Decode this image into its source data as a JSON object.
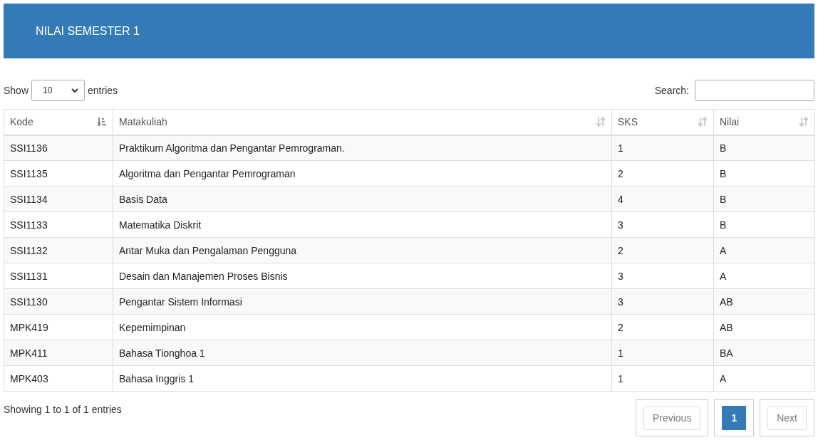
{
  "header": {
    "title": "NILAI SEMESTER 1"
  },
  "length_control": {
    "label_before": "Show",
    "value": "10",
    "label_after": "entries"
  },
  "search": {
    "label": "Search:"
  },
  "table": {
    "columns": [
      {
        "label": "Kode",
        "sorted": true
      },
      {
        "label": "Matakuliah",
        "sorted": false
      },
      {
        "label": "SKS",
        "sorted": false
      },
      {
        "label": "Nilai",
        "sorted": false
      }
    ],
    "rows": [
      [
        "SSI1136",
        "Praktikum Algoritma dan Pengantar Pemrograman.",
        "1",
        "B"
      ],
      [
        "SSI1135",
        "Algoritma dan Pengantar Pemrograman",
        "2",
        "B"
      ],
      [
        "SSI1134",
        "Basis Data",
        "4",
        "B"
      ],
      [
        "SSI1133",
        "Matematika Diskrit",
        "3",
        "B"
      ],
      [
        "SSI1132",
        "Antar Muka dan Pengalaman Pengguna",
        "2",
        "A"
      ],
      [
        "SSI1131",
        "Desain dan Manajemen Proses Bisnis",
        "3",
        "A"
      ],
      [
        "SSI1130",
        "Pengantar Sistem Informasi",
        "3",
        "AB"
      ],
      [
        "MPK419",
        "Kepemimpinan",
        "2",
        "AB"
      ],
      [
        "MPK411",
        "Bahasa Tionghoa 1",
        "1",
        "BA"
      ],
      [
        "MPK403",
        "Bahasa Inggris 1",
        "1",
        "A"
      ]
    ]
  },
  "info": "Showing 1 to 1 of 1 entries",
  "pagination": [
    {
      "label": "Previous",
      "disabled": true,
      "selected": false
    },
    {
      "label": "1",
      "disabled": false,
      "selected": true
    },
    {
      "label": "Next",
      "disabled": true,
      "selected": false
    }
  ]
}
